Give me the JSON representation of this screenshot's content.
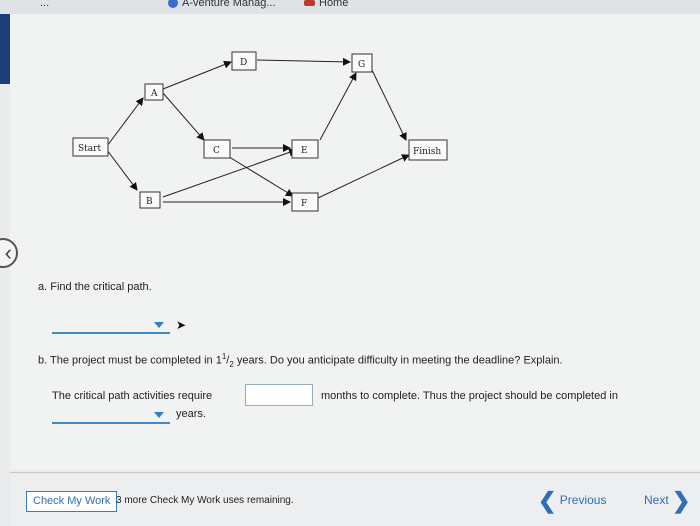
{
  "topbar": {
    "tab1": "...",
    "tab2": "A-venture Manag...",
    "home": "Home"
  },
  "network": {
    "nodes": [
      {
        "id": "start",
        "label": "Start"
      },
      {
        "id": "a",
        "label": "A"
      },
      {
        "id": "b",
        "label": "B"
      },
      {
        "id": "c",
        "label": "C"
      },
      {
        "id": "d",
        "label": "D"
      },
      {
        "id": "e",
        "label": "E"
      },
      {
        "id": "f",
        "label": "F"
      },
      {
        "id": "g",
        "label": "G"
      },
      {
        "id": "finish",
        "label": "Finish"
      }
    ]
  },
  "question_a": {
    "text": "a. Find the critical path.",
    "selected": ""
  },
  "question_b": {
    "text_pre": "b. The project must be completed in 1",
    "frac_num": "1",
    "frac_den": "2",
    "text_post": " years. Do you anticipate difficulty in meeting the deadline? Explain.",
    "line1_pre": "The critical path activities require",
    "input_value": "",
    "line1_post": "months to complete. Thus the project should be completed in",
    "dropdown_value": "",
    "line2_post": "years."
  },
  "footer": {
    "check_label": "Check My Work",
    "remaining": "3 more Check My Work uses remaining.",
    "previous": "Previous",
    "next": "Next"
  }
}
